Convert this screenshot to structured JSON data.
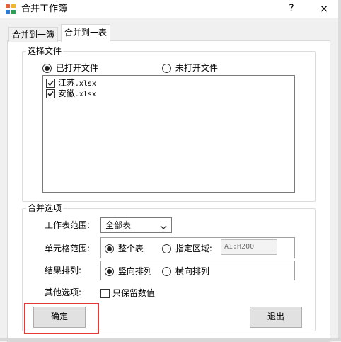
{
  "window": {
    "title": "合并工作簿",
    "help": "?",
    "close": "×"
  },
  "tabs": [
    {
      "label": "合并到一簿",
      "active": false
    },
    {
      "label": "合并到一表",
      "active": true
    }
  ],
  "select_files": {
    "legend": "选择文件",
    "options": [
      {
        "label": "已打开文件",
        "selected": true
      },
      {
        "label": "未打开文件",
        "selected": false
      }
    ],
    "files": [
      {
        "name": "江苏",
        "ext": ".xlsx",
        "checked": true
      },
      {
        "name": "安徽",
        "ext": ".xlsx",
        "checked": true
      }
    ]
  },
  "merge_options": {
    "legend": "合并选项",
    "sheet_range": {
      "label": "工作表范围:",
      "value": "全部表"
    },
    "cell_range": {
      "label": "单元格范围:",
      "options": [
        {
          "label": "整个表",
          "selected": true
        },
        {
          "label": "指定区域:",
          "selected": false
        }
      ],
      "range_value": "A1:H200"
    },
    "result_order": {
      "label": "结果排列:",
      "options": [
        {
          "label": "竖向排列",
          "selected": true
        },
        {
          "label": "横向排列",
          "selected": false
        }
      ]
    },
    "other": {
      "label": "其他选项:",
      "keep_values_only": {
        "label": "只保留数值",
        "checked": false
      }
    }
  },
  "buttons": {
    "ok": "确定",
    "exit": "退出"
  },
  "colors": {
    "highlight": "#e53935",
    "panel": "#ffffff",
    "window": "#f0f0f0"
  }
}
